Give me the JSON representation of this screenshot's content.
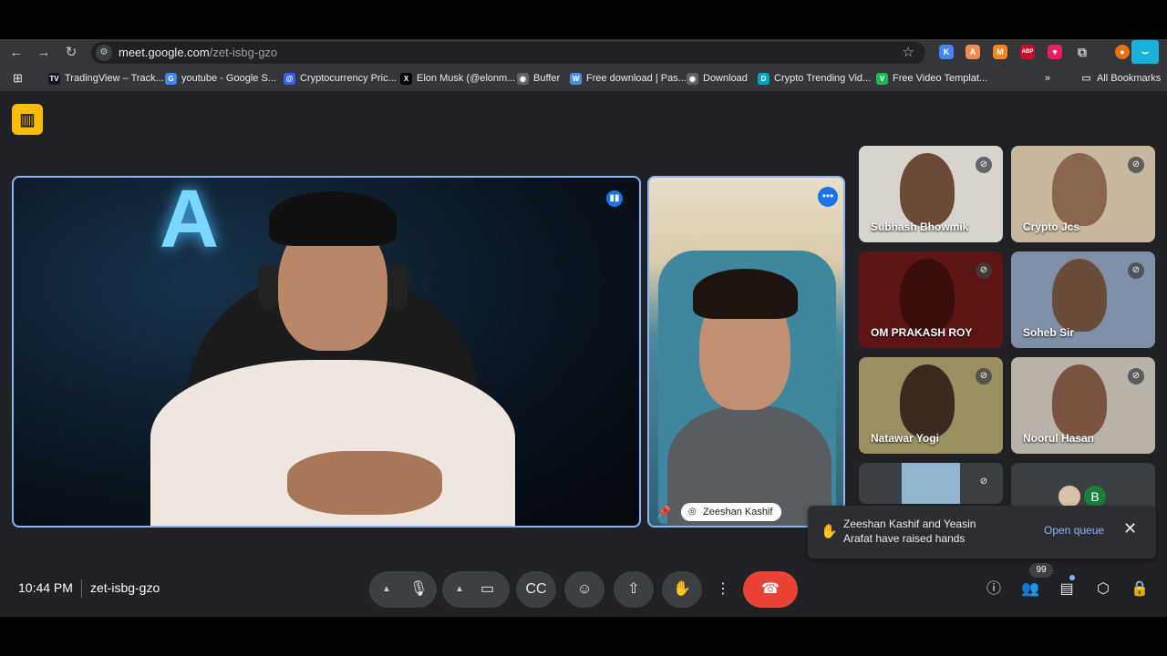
{
  "browser": {
    "url_host": "meet.google.com",
    "url_path": "/zet-isbg-gzo",
    "bookmarks": [
      {
        "label": "TradingView – Track...",
        "icon": "tradingview-icon",
        "color": "#131722",
        "glyph": "TV"
      },
      {
        "label": "youtube - Google S...",
        "icon": "google-icon",
        "color": "#4285f4",
        "glyph": "G"
      },
      {
        "label": "Cryptocurrency Pric...",
        "icon": "coinmarketcap-icon",
        "color": "#3861fb",
        "glyph": "@"
      },
      {
        "label": "Elon Musk (@elonm...",
        "icon": "x-icon",
        "color": "#000000",
        "glyph": "X"
      },
      {
        "label": "Buffer",
        "icon": "buffer-icon",
        "color": "#5f6368",
        "glyph": "◉"
      },
      {
        "label": "Free download | Pas...",
        "icon": "pasteboard-icon",
        "color": "#4a90e2",
        "glyph": "W"
      },
      {
        "label": "Download",
        "icon": "globe-icon",
        "color": "#5f6368",
        "glyph": "◉"
      },
      {
        "label": "Crypto Trending Vid...",
        "icon": "crypto-video-icon",
        "color": "#00a4bd",
        "glyph": "D"
      },
      {
        "label": "Free Video Templat...",
        "icon": "template-icon",
        "color": "#1db954",
        "glyph": "V"
      }
    ],
    "all_bookmarks": "All Bookmarks",
    "extensions": [
      {
        "name": "k-extension-icon",
        "glyph": "K",
        "color": "#4285f4"
      },
      {
        "name": "a-extension-icon",
        "glyph": "A",
        "color": "#f28b50"
      },
      {
        "name": "metamask-icon",
        "glyph": "M",
        "color": "#f6851b"
      },
      {
        "name": "adblock-icon",
        "glyph": "ABP",
        "color": "#c70d2c"
      },
      {
        "name": "heart-extension-icon",
        "glyph": "♥",
        "color": "#e91e63"
      }
    ]
  },
  "meet": {
    "main_participant": {
      "name": "",
      "speaking": true
    },
    "pinned_participant": {
      "name": "Zeeshan Kashif"
    },
    "grid": [
      {
        "name": "Subhash Bhowmik",
        "muted": true,
        "bg": "#d8d4cd",
        "skin": "#6b4a38"
      },
      {
        "name": "Crypto Jcs",
        "muted": true,
        "bg": "#c9b8a0",
        "skin": "#8a6650"
      },
      {
        "name": "OM PRAKASH ROY",
        "muted": true,
        "bg": "#5c1414",
        "skin": "#3a0c0c"
      },
      {
        "name": "Soheb Sir",
        "muted": true,
        "bg": "#7f8fa8",
        "skin": "#6a4c3a"
      },
      {
        "name": "Natawar Yogi",
        "muted": true,
        "bg": "#9a8f60",
        "skin": "#3b2a20"
      },
      {
        "name": "Noorul Hasan",
        "muted": true,
        "bg": "#b8b2a8",
        "skin": "#7a5440"
      },
      {
        "name": "",
        "muted": true,
        "bg": "#3c4043",
        "skin": "#8fb5d0"
      }
    ],
    "overflow_avatar_letter": "B",
    "toast": {
      "message": "Zeeshan Kashif and Yeasin Arafat have raised hands",
      "action": "Open queue"
    },
    "time": "10:44 PM",
    "meeting_code": "zet-isbg-gzo",
    "people_count": "99"
  }
}
